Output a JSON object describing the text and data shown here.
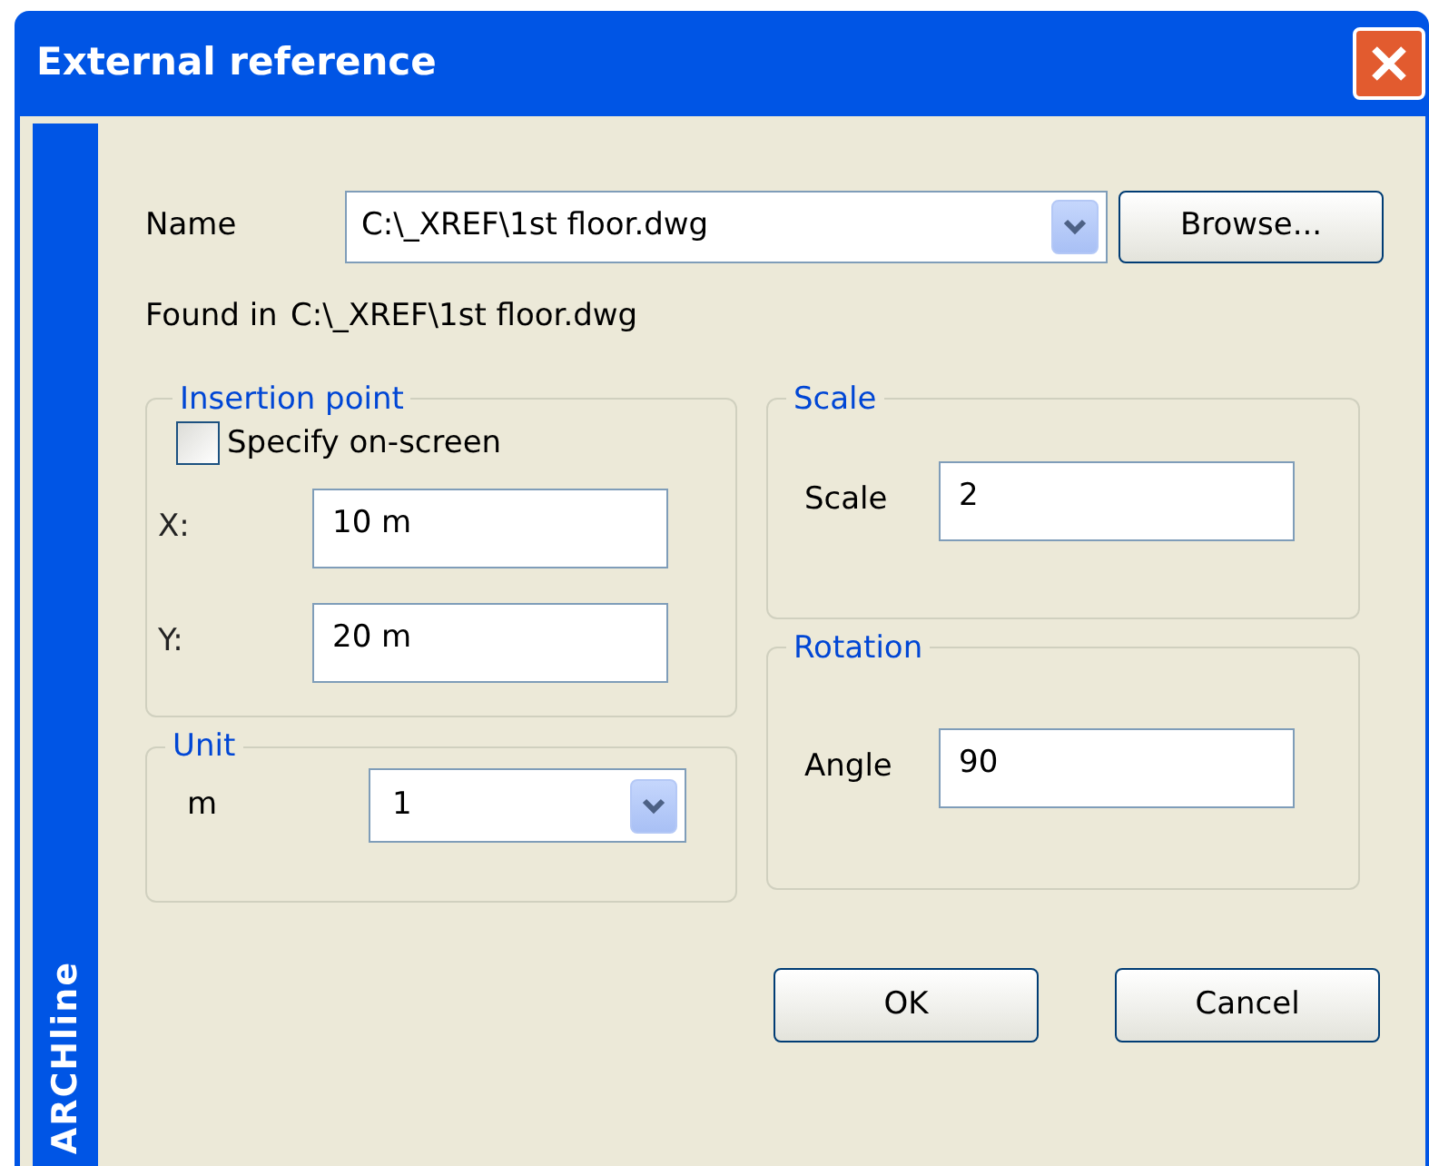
{
  "window": {
    "title": "External reference"
  },
  "sidebar": {
    "brand": "ARCHline"
  },
  "name": {
    "label": "Name",
    "value": "C:\\_XREF\\1st floor.dwg"
  },
  "browse_button": "Browse...",
  "found_in": {
    "label": "Found in",
    "value": "C:\\_XREF\\1st floor.dwg"
  },
  "insertion_point": {
    "title": "Insertion point",
    "specify_on_screen": {
      "label": "Specify on-screen",
      "checked": false
    },
    "fields": [
      {
        "label": "X:",
        "value": "10 m"
      },
      {
        "label": "Y:",
        "value": "20 m"
      }
    ]
  },
  "unit": {
    "title": "Unit",
    "label": "m",
    "value": "1"
  },
  "scale": {
    "title": "Scale",
    "label": "Scale",
    "value": "2"
  },
  "rotation": {
    "title": "Rotation",
    "label": "Angle",
    "value": "90"
  },
  "buttons": [
    "OK",
    "Cancel"
  ]
}
